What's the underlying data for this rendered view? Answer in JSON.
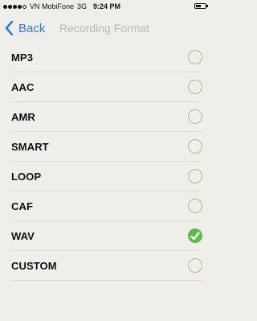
{
  "status_bar": {
    "carrier": "VN MobiFone",
    "network": "3G",
    "time": "9:24 PM"
  },
  "nav": {
    "back_label": "Back",
    "title": "Recording Format"
  },
  "colors": {
    "accent": "#2a7de1",
    "check": "#5cbd45",
    "radio_border": "#8bcf7d"
  },
  "formats": [
    {
      "label": "MP3",
      "selected": false
    },
    {
      "label": "AAC",
      "selected": false
    },
    {
      "label": "AMR",
      "selected": false
    },
    {
      "label": "SMART",
      "selected": false
    },
    {
      "label": "LOOP",
      "selected": false
    },
    {
      "label": "CAF",
      "selected": false
    },
    {
      "label": "WAV",
      "selected": true
    },
    {
      "label": "CUSTOM",
      "selected": false
    }
  ]
}
